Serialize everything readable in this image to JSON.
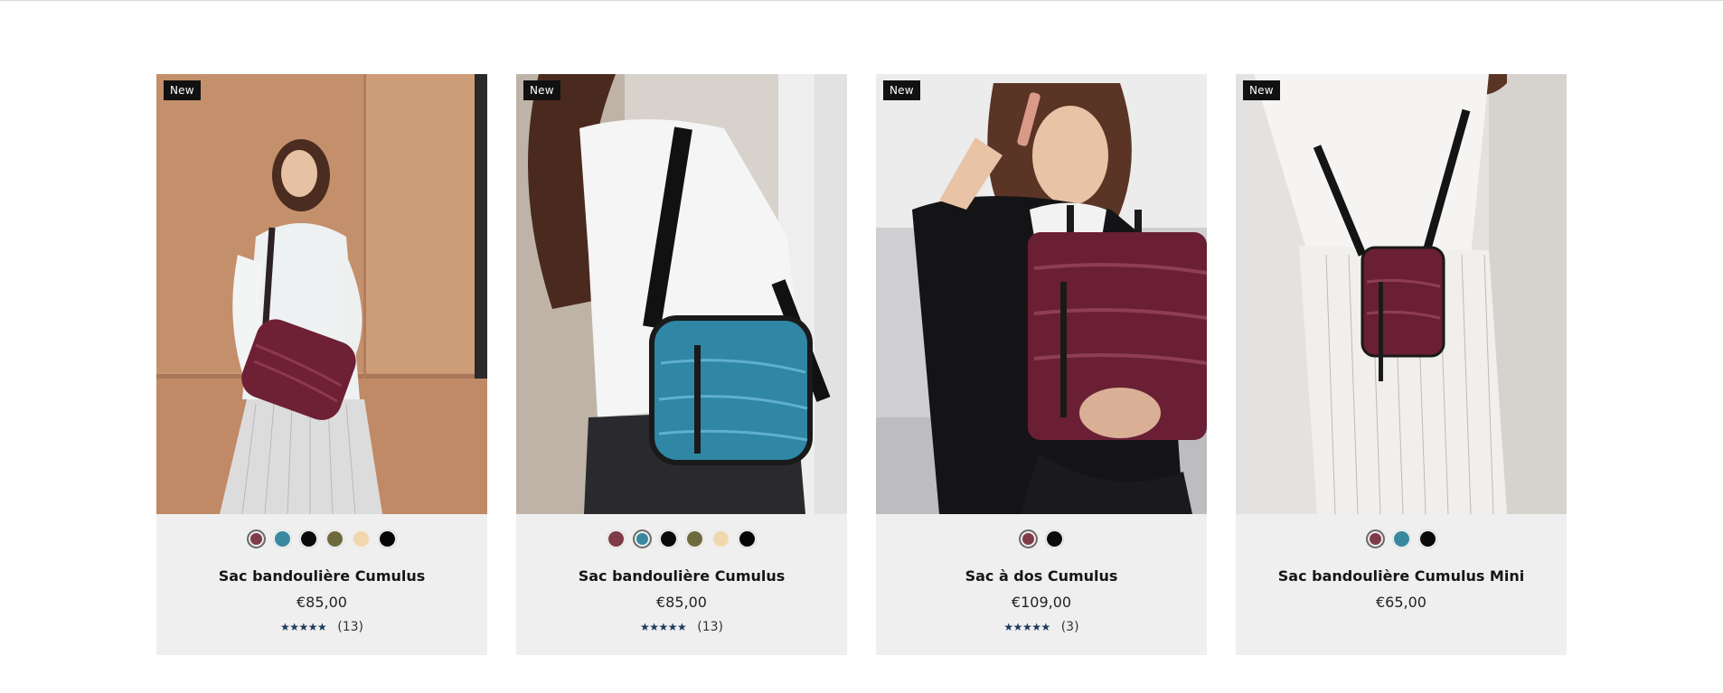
{
  "products": [
    {
      "badge": "New",
      "title": "Sac bandoulière Cumulus",
      "price": "€85,00",
      "stars": "★★★★★",
      "reviews": "(13)",
      "rating": 5,
      "swatches": [
        {
          "color": "#803b48",
          "selected": true
        },
        {
          "color": "#3a88a0",
          "selected": false
        },
        {
          "color": "#0a0a0a",
          "selected": false
        },
        {
          "color": "#6f6a3e",
          "selected": false
        },
        {
          "color": "#f0d7ad",
          "selected": false
        },
        {
          "color": "#050505",
          "selected": false
        }
      ]
    },
    {
      "badge": "New",
      "title": "Sac bandoulière Cumulus",
      "price": "€85,00",
      "stars": "★★★★★",
      "reviews": "(13)",
      "rating": 5,
      "swatches": [
        {
          "color": "#803b48",
          "selected": false
        },
        {
          "color": "#3a88a0",
          "selected": true
        },
        {
          "color": "#0a0a0a",
          "selected": false
        },
        {
          "color": "#6f6a3e",
          "selected": false
        },
        {
          "color": "#f0d7ad",
          "selected": false
        },
        {
          "color": "#050505",
          "selected": false
        }
      ]
    },
    {
      "badge": "New",
      "title": "Sac à dos Cumulus",
      "price": "€109,00",
      "stars": "★★★★★",
      "reviews": "(3)",
      "rating": 5,
      "swatches": [
        {
          "color": "#803b48",
          "selected": true
        },
        {
          "color": "#0a0a0a",
          "selected": false
        }
      ]
    },
    {
      "badge": "New",
      "title": "Sac bandoulière Cumulus Mini",
      "price": "€65,00",
      "swatches": [
        {
          "color": "#803b48",
          "selected": true
        },
        {
          "color": "#3a88a0",
          "selected": false
        },
        {
          "color": "#0a0a0a",
          "selected": false
        }
      ]
    }
  ]
}
